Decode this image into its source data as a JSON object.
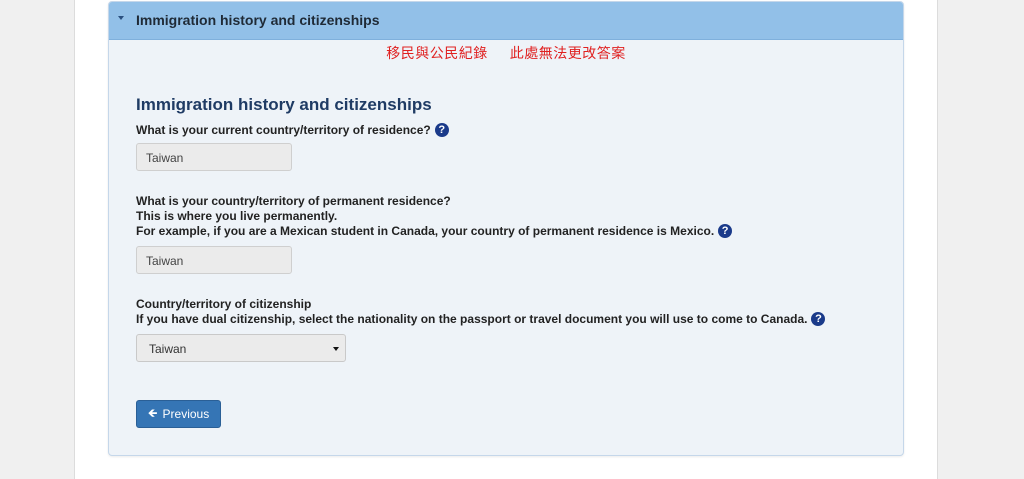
{
  "panel": {
    "header_title": "Immigration history and citizenships",
    "note": [
      "移民與公民紀錄",
      "此處無法更改答案"
    ]
  },
  "section": {
    "heading": "Immigration history and citizenships"
  },
  "current_residence": {
    "label": "What is your current country/territory of residence?",
    "value": "Taiwan"
  },
  "permanent_residence": {
    "label_line1": "What is your country/territory of permanent residence?",
    "label_line2": "This is where you live permanently.",
    "label_line3": "For example, if you are a Mexican student in Canada, your country of permanent residence is Mexico.",
    "value": "Taiwan"
  },
  "citizenship": {
    "label_line1": "Country/territory of citizenship",
    "label_line2": "If you have dual citizenship, select the nationality on the passport or travel document you will use to come to Canada.",
    "selected": "Taiwan"
  },
  "buttons": {
    "previous_label": "Previous"
  },
  "help_glyph": "?",
  "icons": {
    "help": "question-circle-icon",
    "caret": "caret-down-icon",
    "previous": "arrow-left-icon",
    "select_arrow": "dropdown-arrow-icon"
  },
  "colors": {
    "header_bg": "#92c0e8",
    "heading": "#1f3b64",
    "note": "#e02020",
    "button": "#3575b5",
    "help_icon": "#1a3a8a"
  }
}
